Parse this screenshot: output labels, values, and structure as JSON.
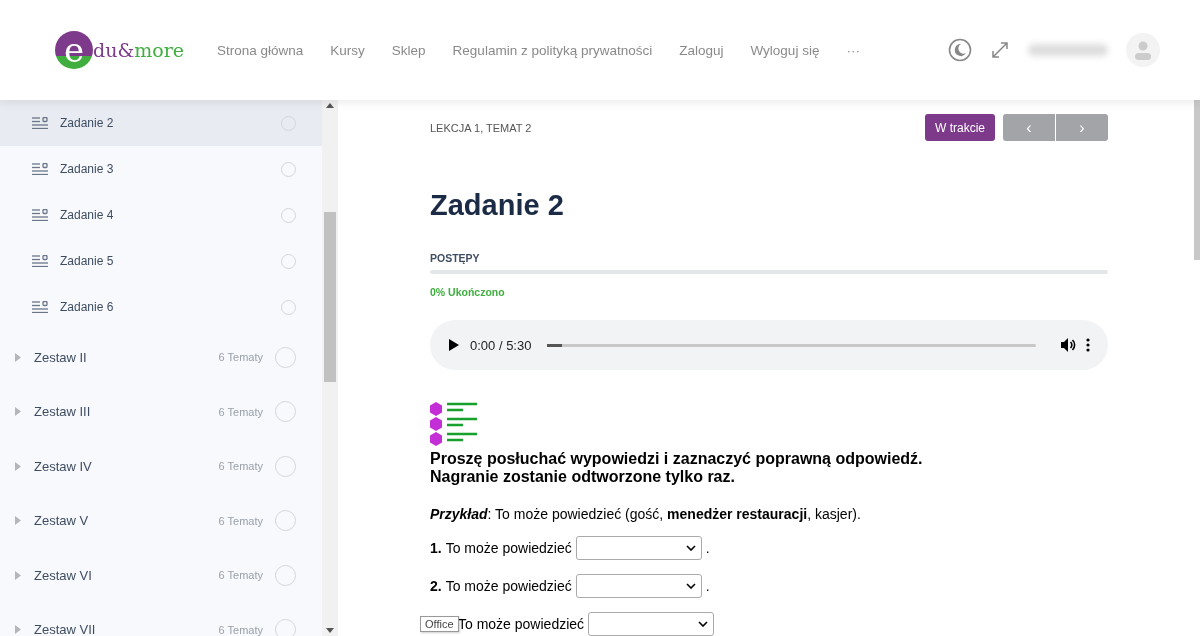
{
  "header": {
    "logo": {
      "initial": "e",
      "part1": "du&",
      "part2": "more"
    },
    "nav": [
      {
        "label": "Strona główna"
      },
      {
        "label": "Kursy"
      },
      {
        "label": "Sklep"
      },
      {
        "label": "Regulamin z polityką prywatności"
      },
      {
        "label": "Zaloguj"
      },
      {
        "label": "Wyloguj się"
      },
      {
        "label": "···"
      }
    ]
  },
  "sidebar": {
    "items": [
      {
        "kind": "topic",
        "label": "Zadanie 2",
        "selected": true,
        "completed": false
      },
      {
        "kind": "topic",
        "label": "Zadanie 3",
        "selected": false,
        "completed": false
      },
      {
        "kind": "topic",
        "label": "Zadanie 4",
        "selected": false,
        "completed": false
      },
      {
        "kind": "topic",
        "label": "Zadanie 5",
        "selected": false,
        "completed": false
      },
      {
        "kind": "topic",
        "label": "Zadanie 6",
        "selected": false,
        "completed": false
      },
      {
        "kind": "section",
        "label": "Zestaw II",
        "count": "6 Tematy",
        "expanded": false,
        "completed": false
      },
      {
        "kind": "section",
        "label": "Zestaw III",
        "count": "6 Tematy",
        "expanded": false,
        "completed": false
      },
      {
        "kind": "section",
        "label": "Zestaw IV",
        "count": "6 Tematy",
        "expanded": false,
        "completed": false
      },
      {
        "kind": "section",
        "label": "Zestaw V",
        "count": "6 Tematy",
        "expanded": false,
        "completed": false
      },
      {
        "kind": "section",
        "label": "Zestaw VI",
        "count": "6 Tematy",
        "expanded": false,
        "completed": false
      },
      {
        "kind": "section",
        "label": "Zestaw VII",
        "count": "6 Tematy",
        "expanded": false,
        "completed": false
      }
    ]
  },
  "lesson": {
    "breadcrumb": "LEKCJA 1, TEMAT 2",
    "status_button": "W trakcie",
    "prev": "‹",
    "next": "›",
    "title": "Zadanie 2",
    "progress_label": "POSTĘPY",
    "progress": {
      "level": 0
    },
    "progress_text": "0% Ukończono",
    "audio": {
      "time": "0:00 / 5:30",
      "level": 0.03
    },
    "instruction": [
      "Proszę posłuchać wypowiedzi i zaznaczyć poprawną odpowiedź.",
      "Nagranie zostanie odtworzone tylko raz."
    ],
    "example_label": "Przykład",
    "example": ": To może powiedzieć (gość, **menedżer restauracji**, kasjer).",
    "questions": [
      {
        "number": "1.",
        "text": "To może powiedzieć",
        "after": "."
      },
      {
        "number": "2.",
        "text": "To może powiedzieć",
        "after": "."
      },
      {
        "text": "To może powiedzieć"
      }
    ],
    "tooltip": "Office"
  }
}
